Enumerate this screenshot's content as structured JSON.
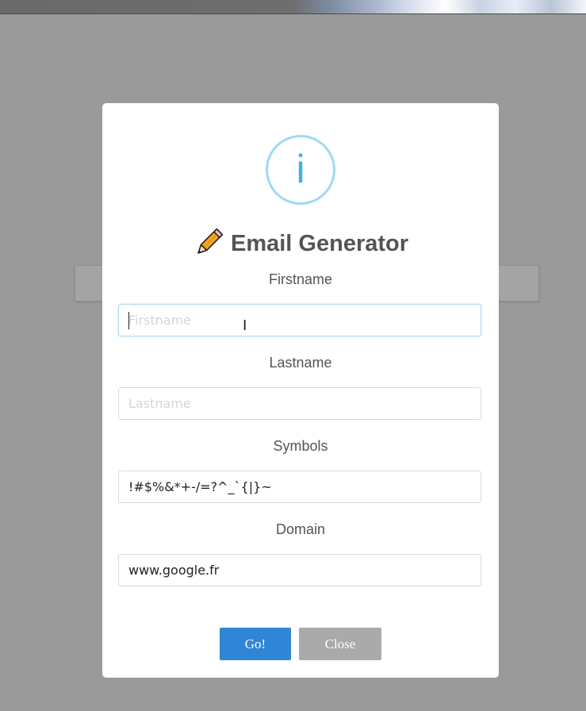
{
  "dialog": {
    "title": "Email Generator",
    "info_glyph": "i",
    "title_icon": "pencil-icon",
    "fields": {
      "firstname": {
        "label": "Firstname",
        "placeholder": "Firstname",
        "value": ""
      },
      "lastname": {
        "label": "Lastname",
        "placeholder": "Lastname",
        "value": ""
      },
      "symbols": {
        "label": "Symbols",
        "placeholder": "",
        "value": "!#$%&*+-/=?^_`{|}~"
      },
      "domain": {
        "label": "Domain",
        "placeholder": "",
        "value": "www.google.fr"
      }
    },
    "buttons": {
      "go": "Go!",
      "close": "Close"
    }
  },
  "colors": {
    "overlay": "#9a9a9a",
    "go_button": "#3085d6",
    "close_button": "#aaaaaa",
    "info_ring": "#9dd9f3",
    "info_glyph": "#3fb3e8",
    "title_text": "#545454"
  },
  "cursor_glyph": "I"
}
